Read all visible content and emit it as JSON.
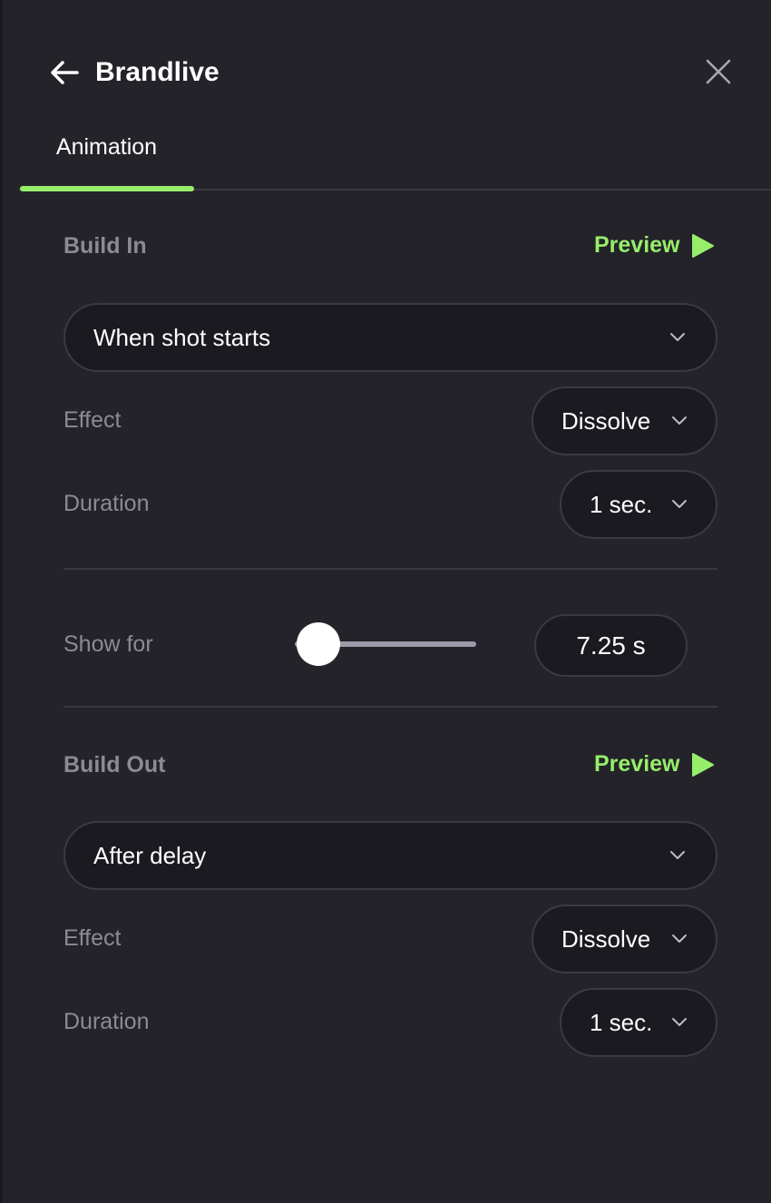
{
  "header": {
    "title": "Brandlive",
    "back_icon": "arrow-left-icon",
    "close_icon": "close-icon"
  },
  "tabs": [
    {
      "label": "Animation",
      "active": true
    }
  ],
  "colors": {
    "accent": "#96ee6a",
    "background": "#242329",
    "control_bg": "#1b1a20",
    "muted_text": "#8c8a96"
  },
  "build_in": {
    "title": "Build In",
    "preview_label": "Preview",
    "trigger": "When shot starts",
    "effect_label": "Effect",
    "effect_value": "Dissolve",
    "duration_label": "Duration",
    "duration_value": "1 sec."
  },
  "show_for": {
    "label": "Show for",
    "value_text": "7.25 s",
    "slider_fraction": 0.13
  },
  "build_out": {
    "title": "Build Out",
    "preview_label": "Preview",
    "trigger": "After delay",
    "effect_label": "Effect",
    "effect_value": "Dissolve",
    "duration_label": "Duration",
    "duration_value": "1 sec."
  }
}
